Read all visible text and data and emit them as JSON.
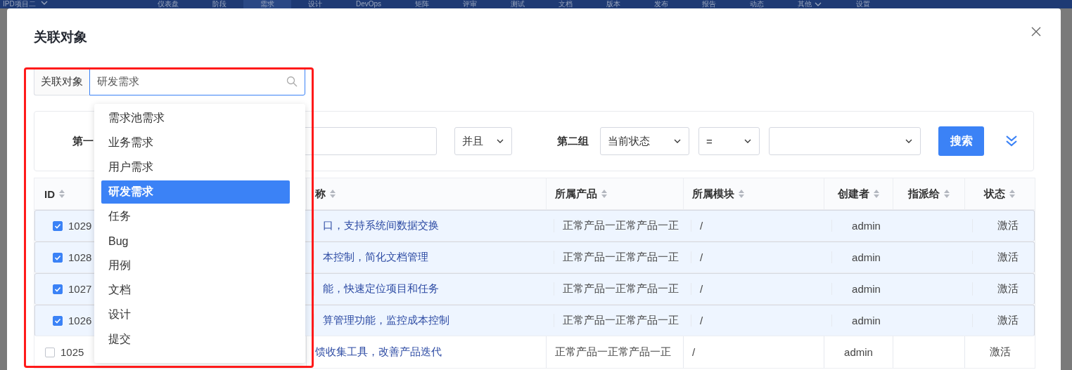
{
  "nav": {
    "project": "IPD项目二",
    "items": [
      {
        "label": "仪表盘",
        "selected": false,
        "dropdown": false
      },
      {
        "label": "阶段",
        "selected": false,
        "dropdown": false
      },
      {
        "label": "需求",
        "selected": true,
        "dropdown": false
      },
      {
        "label": "设计",
        "selected": false,
        "dropdown": false
      },
      {
        "label": "DevOps",
        "selected": false,
        "dropdown": false
      },
      {
        "label": "矩阵",
        "selected": false,
        "dropdown": false
      },
      {
        "label": "评审",
        "selected": false,
        "dropdown": false
      },
      {
        "label": "测试",
        "selected": false,
        "dropdown": false
      },
      {
        "label": "文档",
        "selected": false,
        "dropdown": false
      },
      {
        "label": "版本",
        "selected": false,
        "dropdown": false
      },
      {
        "label": "发布",
        "selected": false,
        "dropdown": false
      },
      {
        "label": "报告",
        "selected": false,
        "dropdown": false
      },
      {
        "label": "动态",
        "selected": false,
        "dropdown": false
      },
      {
        "label": "其他",
        "selected": false,
        "dropdown": true
      },
      {
        "label": "设置",
        "selected": false,
        "dropdown": false
      }
    ]
  },
  "dialog": {
    "title": "关联对象"
  },
  "object_picker": {
    "label": "关联对象",
    "value": "研发需求",
    "options": [
      {
        "label": "需求池需求",
        "selected": false
      },
      {
        "label": "业务需求",
        "selected": false
      },
      {
        "label": "用户需求",
        "selected": false
      },
      {
        "label": "研发需求",
        "selected": true
      },
      {
        "label": "任务",
        "selected": false
      },
      {
        "label": "Bug",
        "selected": false
      },
      {
        "label": "用例",
        "selected": false
      },
      {
        "label": "文档",
        "selected": false
      },
      {
        "label": "设计",
        "selected": false
      },
      {
        "label": "提交",
        "selected": false
      }
    ]
  },
  "filter": {
    "group1_label": "第一",
    "conjunction": "并且",
    "group2_label": "第二组",
    "field": "当前状态",
    "operator": "=",
    "search_button": "搜索"
  },
  "table": {
    "columns": [
      {
        "label": "ID"
      },
      {
        "label": "称"
      },
      {
        "label": "所属产品"
      },
      {
        "label": "所属模块"
      },
      {
        "label": "创建者"
      },
      {
        "label": "指派给"
      },
      {
        "label": "状态"
      }
    ],
    "rows": [
      {
        "checked": true,
        "id": "1029",
        "title": "口，支持系统间数据交换",
        "product": "正常产品一正常产品一正",
        "module": "/",
        "creator": "admin",
        "status": "激活"
      },
      {
        "checked": true,
        "id": "1028",
        "title": "本控制，简化文档管理",
        "product": "正常产品一正常产品一正",
        "module": "/",
        "creator": "admin",
        "status": "激活"
      },
      {
        "checked": true,
        "id": "1027",
        "title": "能，快速定位项目和任务",
        "product": "正常产品一正常产品一正",
        "module": "/",
        "creator": "admin",
        "status": "激活"
      },
      {
        "checked": true,
        "id": "1026",
        "title": "算管理功能，监控成本控制",
        "product": "正常产品一正常产品一正",
        "module": "/",
        "creator": "admin",
        "status": "激活"
      },
      {
        "checked": false,
        "id": "1025",
        "title": "馈收集工具，改善产品迭代",
        "product": "正常产品一正常产品一正",
        "module": "/",
        "creator": "admin",
        "status": "激活"
      }
    ]
  }
}
